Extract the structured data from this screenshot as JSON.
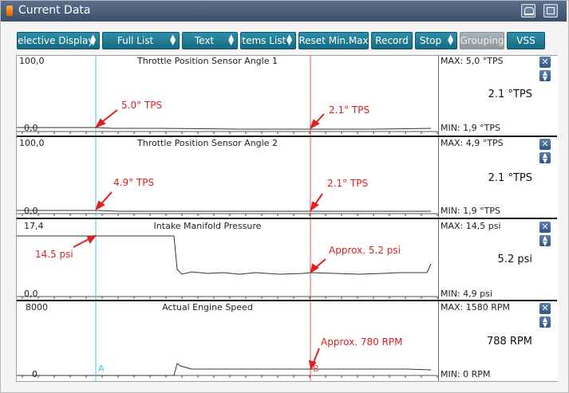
{
  "window": {
    "title": "Current Data",
    "retro_icon": "retro-icon",
    "maximize_icon": "maximize-icon"
  },
  "toolbar": {
    "selective_display": "Selective Display",
    "full_list": "Full List",
    "text": "Text",
    "items_list": "Items List",
    "reset_minmax": "Reset Min.Max",
    "record": "Record",
    "stop": "Stop",
    "grouping": "Grouping",
    "vss": "VSS"
  },
  "panels": [
    {
      "title": "Throttle Position Sensor Angle 1",
      "ymax": "100,0",
      "ymin": "0,0",
      "max": "MAX:   5,0 °TPS",
      "min": "MIN:   1,9 °TPS",
      "current": "2.1 °TPS",
      "ann_a": "5.0° TPS",
      "ann_b": "2.1° TPS"
    },
    {
      "title": "Throttle Position Sensor Angle 2",
      "ymax": "100,0",
      "ymin": "0,0",
      "max": "MAX:   4,9 °TPS",
      "min": "MIN:   1,9 °TPS",
      "current": "2.1 °TPS",
      "ann_a": "4.9° TPS",
      "ann_b": "2.1° TPS"
    },
    {
      "title": "Intake Manifold Pressure",
      "ymax": "17,4",
      "ymin": "0,0",
      "max": "MAX:  14,5 psi",
      "min": "MIN:   4,9 psi",
      "current": "5.2 psi",
      "ann_a": "14.5 psi",
      "ann_b": "Approx. 5.2 psi"
    },
    {
      "title": "Actual Engine Speed",
      "ymax": "8000",
      "ymin": "0",
      "max": "MAX:  1580 RPM",
      "min": "MIN:      0 RPM",
      "current": "788 RPM",
      "ann_a": "",
      "ann_b": "Approx. 780 RPM"
    }
  ],
  "cursors": {
    "a_label": "A",
    "b_label": "B",
    "a_color": "#40d0d8",
    "b_color": "#e06050"
  },
  "colors": {
    "annotation": "#e02020",
    "button": "#1f7d96",
    "title_bar": "#4a5e7a"
  }
}
